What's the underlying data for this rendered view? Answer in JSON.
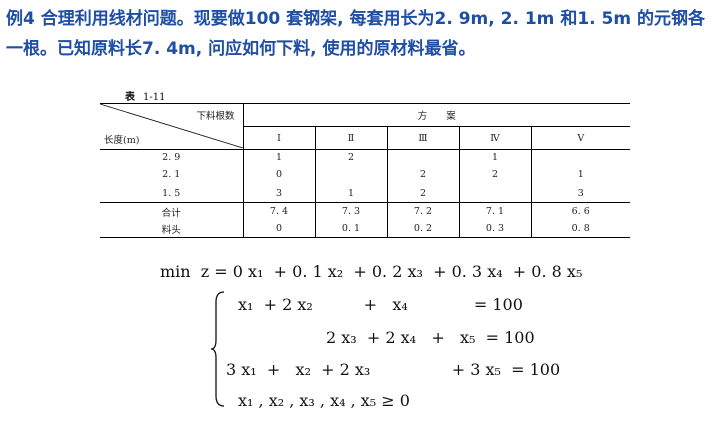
{
  "problem": {
    "text": "例4 合理利用线材问题。现要做100 套钢架, 每套用长为2. 9m, 2. 1m 和1. 5m 的元钢各一根。已知原料长7. 4m, 问应如何下料, 使用的原材料最省。"
  },
  "table": {
    "label": "表",
    "number": "1-11",
    "header_top": "下料根数",
    "header_left": "长度(m)",
    "scheme_title": "方　　案",
    "columns": [
      "I",
      "Ⅱ",
      "Ⅲ",
      "Ⅳ",
      "V"
    ],
    "rows": [
      {
        "label": "2. 9",
        "cells": [
          "1",
          "2",
          "",
          "1",
          ""
        ]
      },
      {
        "label": "2. 1",
        "cells": [
          "0",
          "",
          "2",
          "2",
          "1"
        ]
      },
      {
        "label": "1. 5",
        "cells": [
          "3",
          "1",
          "2",
          "",
          "3"
        ]
      }
    ],
    "total_label": "合计",
    "totals": [
      "7. 4",
      "7. 3",
      "7. 2",
      "7. 1",
      "6. 6"
    ],
    "waste_label": "料头",
    "waste": [
      "0",
      "0. 1",
      "0. 2",
      "0. 3",
      "0. 8"
    ]
  },
  "model": {
    "objective": "min  z = 0 x₁  + 0. 1 x₂  + 0. 2 x₃  + 0. 3 x₄  + 0. 8 x₅",
    "c1": "x₁  + 2 x₂          +   x₄             = 100",
    "c2": "2 x₃  + 2 x₄   +   x₅  = 100",
    "c3": "3 x₁  +   x₂  + 2 x₃                + 3 x₅  = 100",
    "c4": "x₁ , x₂ , x₃ , x₄ , x₅ ≥ 0"
  }
}
